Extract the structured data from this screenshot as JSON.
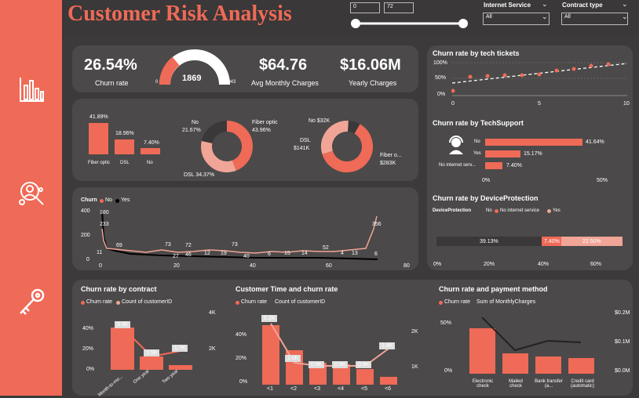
{
  "title": "Customer Risk Analysis",
  "colors": {
    "accent": "#ef6a57",
    "light": "#f0a596",
    "dark": "#3a3838"
  },
  "tenure_filter": {
    "min": "0",
    "max": "72"
  },
  "filters": {
    "internet": {
      "label": "Internet Service",
      "value": "All"
    },
    "contract": {
      "label": "Contract type",
      "value": "All"
    }
  },
  "kpi": {
    "churn_rate": "26.54%",
    "churn_rate_label": "Churn rate",
    "gauge_value": "1869",
    "gauge_min": "0",
    "gauge_max": "7043",
    "avg_monthly": "$64.76",
    "avg_monthly_label": "Avg Monthly Charges",
    "yearly": "$16.06M",
    "yearly_label": "Yearly Charges"
  },
  "internet_bars": {
    "labels": [
      "Fiber optic",
      "DSL",
      "No"
    ],
    "values": [
      "41.89%",
      "18.96%",
      "7.40%"
    ]
  },
  "donut1": {
    "labels": {
      "no": "No",
      "no_pct": "21.67%",
      "fiber": "Fiber optic",
      "fiber_pct": "43.96%",
      "dsl": "DSL 34.37%"
    }
  },
  "donut2": {
    "labels": {
      "no": "No $32K",
      "dsl": "DSL",
      "dsl_val": "$141K",
      "fiber": "Fiber o...",
      "fiber_val": "$283K"
    }
  },
  "churn_line": {
    "legend_title": "Churn",
    "legend_no": "No",
    "legend_yes": "Yes",
    "yticks": [
      "400",
      "200",
      "0"
    ],
    "xticks": [
      "0",
      "20",
      "40",
      "60",
      "80"
    ],
    "annotations": [
      "380",
      "233",
      "11",
      "69",
      "73",
      "27",
      "46",
      "72",
      "12",
      "19",
      "73",
      "40",
      "6",
      "15",
      "14",
      "52",
      "4",
      "13",
      "356",
      "6"
    ]
  },
  "tickets": {
    "title": "Churn rate by tech tickets",
    "yticks": [
      "100%",
      "50%",
      "0%"
    ],
    "xticks": [
      "0",
      "5",
      "10"
    ]
  },
  "techsupport": {
    "title": "Churn rate by TechSupport",
    "cats": [
      "No",
      "Yes",
      "No internet serv..."
    ],
    "values": [
      "41.64%",
      "15.17%",
      "7.40%"
    ],
    "xticks": [
      "0%",
      "50%"
    ]
  },
  "deviceprot": {
    "title": "Churn rate by DeviceProtection",
    "legend_title": "DeviceProtection",
    "legend": [
      "No",
      "No internet service",
      "Yes"
    ],
    "values": [
      "39.13%",
      "7.40%",
      "22.50%"
    ],
    "xticks": [
      "0%",
      "20%",
      "40%",
      "60%"
    ]
  },
  "contract": {
    "title": "Churn rate by contract",
    "legend": [
      "Churn rate",
      "Count of customerID"
    ],
    "cats": [
      "Month-to-mo...",
      "One year",
      "Two year"
    ],
    "count_labels": [
      "3.9K",
      "1.5K",
      "1.7K"
    ],
    "yleft": [
      "40%",
      "20%",
      "0%"
    ],
    "yright": [
      "4K",
      "2K"
    ]
  },
  "tenure": {
    "title": "Customer Time and churn rate",
    "legend": [
      "Churn rate",
      "Count of customerID"
    ],
    "cats": [
      "<1",
      "<2",
      "<3",
      "<4",
      "<5",
      "<6"
    ],
    "count_labels": [
      "2.2K",
      "1.0K",
      "0.8K",
      "0.8K",
      "0.8K",
      "1.4K"
    ],
    "yleft": [
      "40%",
      "20%",
      "0%"
    ],
    "yright": [
      "2K",
      "1K"
    ]
  },
  "payment": {
    "title": "Churn rate and payment method",
    "legend": [
      "Churn rate",
      "Sum of MonthlyCharges"
    ],
    "cats": [
      "Electronic check",
      "Mailed check",
      "Bank transfer (a...",
      "Credit card (automatic)"
    ],
    "yleft": [
      "50%",
      "0%"
    ],
    "yright": [
      "$0.2M",
      "$0.1M",
      "$0.0M"
    ]
  }
}
